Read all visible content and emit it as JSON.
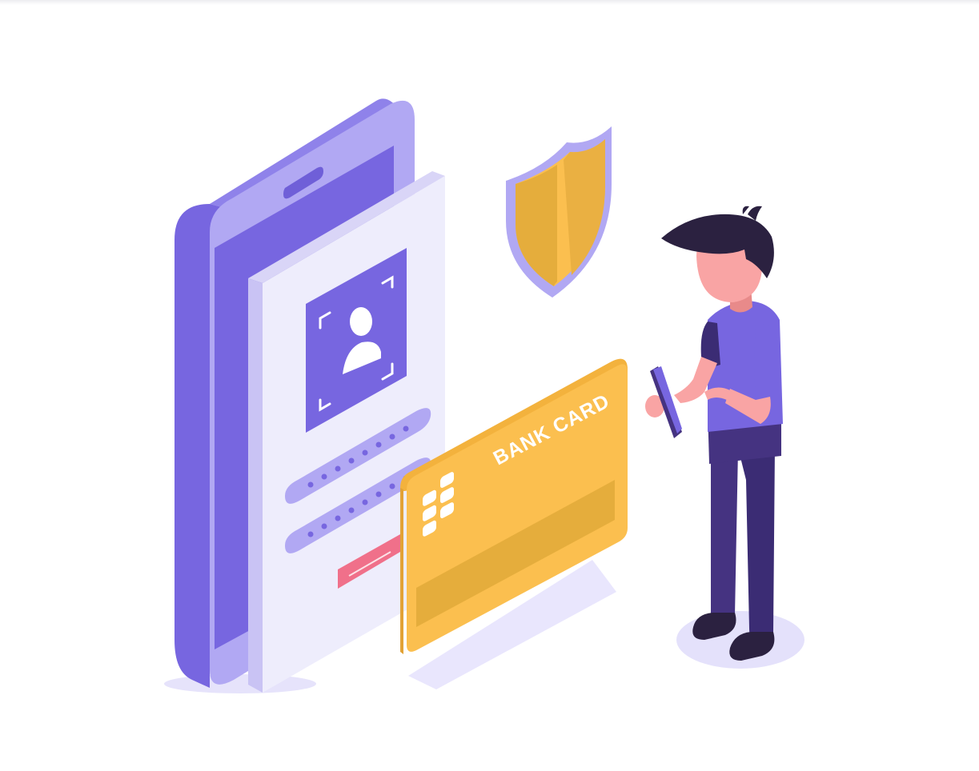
{
  "illustration": {
    "card_text": "BANK CARD",
    "colors": {
      "primary_purple": "#7766e0",
      "light_purple": "#b1a8f3",
      "pale_purple": "#eeedfc",
      "card_yellow": "#fbbf4f",
      "shield_gold": "#e5ad3c",
      "button_pink": "#f0708a",
      "hair": "#2b2140",
      "skin": "#f9a4a4",
      "pants": "#453381"
    },
    "icons": [
      "smartphone",
      "profile-photo-icon",
      "password-field",
      "shield-icon",
      "bank-card",
      "person-with-phone"
    ]
  }
}
